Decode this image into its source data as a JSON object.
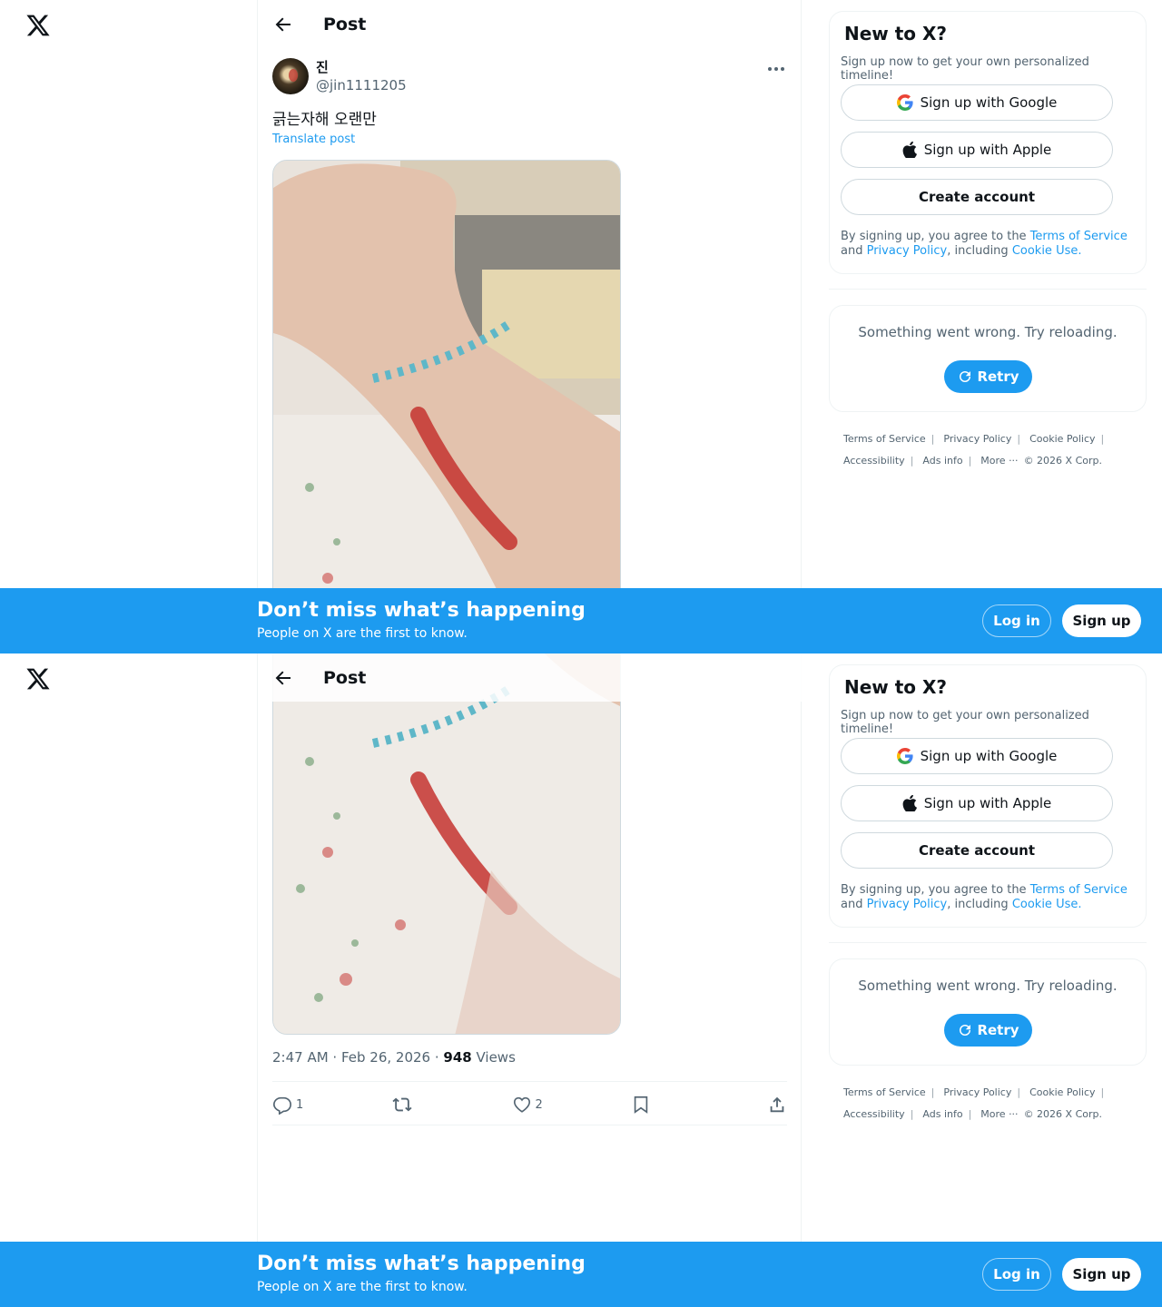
{
  "header": {
    "title": "Post"
  },
  "post": {
    "display_name": "진",
    "handle": "@jin1111205",
    "text": "긁는자해 오랜만",
    "translate_label": "Translate post",
    "time": "2:47 AM · Feb 26, 2026 · ",
    "views_count": "948",
    "views_label": " Views",
    "replies": "1",
    "retweets": "",
    "likes": "2"
  },
  "sidebar": {
    "new_title": "New to X?",
    "new_sub": "Sign up now to get your own personalized timeline!",
    "google_label": "Sign up with Google",
    "apple_label": "Sign up with Apple",
    "create_label": "Create account",
    "legal_prefix": "By signing up, you agree to the ",
    "terms_link": "Terms of Service",
    "and": " and ",
    "privacy_link": "Privacy Policy",
    "including": ", including ",
    "cookie_link": "Cookie Use.",
    "error_msg": "Something went wrong. Try reloading.",
    "retry_label": "Retry",
    "footer": {
      "terms": "Terms of Service",
      "privacy": "Privacy Policy",
      "cookie": "Cookie Policy",
      "accessibility": "Accessibility",
      "ads": "Ads info",
      "more": "More ···",
      "copyright": "© 2026 X Corp."
    }
  },
  "banner": {
    "title": "Don’t miss what’s happening",
    "sub": "People on X are the first to know.",
    "login": "Log in",
    "signup": "Sign up"
  },
  "colors": {
    "accent": "#1d9bf0",
    "text": "#0f1419",
    "muted": "#536471"
  }
}
